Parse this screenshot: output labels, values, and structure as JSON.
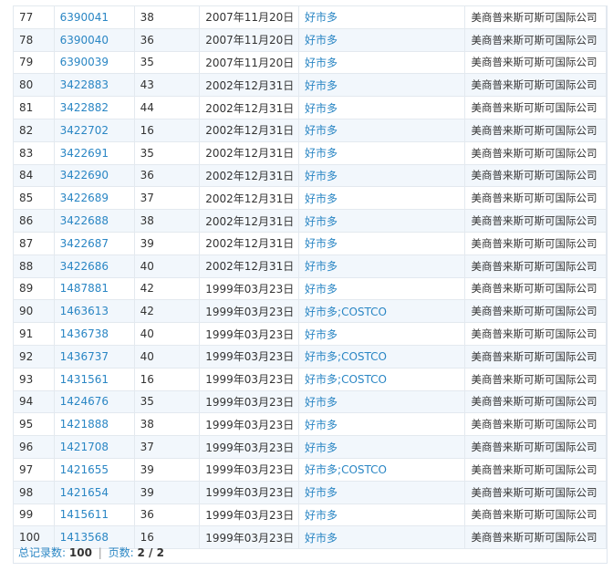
{
  "rows": [
    {
      "idx": "77",
      "reg_no": "6390041",
      "class": "38",
      "date": "2007年11月20日",
      "name": "好市多",
      "owner": "美商普来斯可斯可国际公司"
    },
    {
      "idx": "78",
      "reg_no": "6390040",
      "class": "36",
      "date": "2007年11月20日",
      "name": "好市多",
      "owner": "美商普来斯可斯可国际公司"
    },
    {
      "idx": "79",
      "reg_no": "6390039",
      "class": "35",
      "date": "2007年11月20日",
      "name": "好市多",
      "owner": "美商普来斯可斯可国际公司"
    },
    {
      "idx": "80",
      "reg_no": "3422883",
      "class": "43",
      "date": "2002年12月31日",
      "name": "好市多",
      "owner": "美商普来斯可斯可国际公司"
    },
    {
      "idx": "81",
      "reg_no": "3422882",
      "class": "44",
      "date": "2002年12月31日",
      "name": "好市多",
      "owner": "美商普来斯可斯可国际公司"
    },
    {
      "idx": "82",
      "reg_no": "3422702",
      "class": "16",
      "date": "2002年12月31日",
      "name": "好市多",
      "owner": "美商普来斯可斯可国际公司"
    },
    {
      "idx": "83",
      "reg_no": "3422691",
      "class": "35",
      "date": "2002年12月31日",
      "name": "好市多",
      "owner": "美商普来斯可斯可国际公司"
    },
    {
      "idx": "84",
      "reg_no": "3422690",
      "class": "36",
      "date": "2002年12月31日",
      "name": "好市多",
      "owner": "美商普来斯可斯可国际公司"
    },
    {
      "idx": "85",
      "reg_no": "3422689",
      "class": "37",
      "date": "2002年12月31日",
      "name": "好市多",
      "owner": "美商普来斯可斯可国际公司"
    },
    {
      "idx": "86",
      "reg_no": "3422688",
      "class": "38",
      "date": "2002年12月31日",
      "name": "好市多",
      "owner": "美商普来斯可斯可国际公司"
    },
    {
      "idx": "87",
      "reg_no": "3422687",
      "class": "39",
      "date": "2002年12月31日",
      "name": "好市多",
      "owner": "美商普来斯可斯可国际公司"
    },
    {
      "idx": "88",
      "reg_no": "3422686",
      "class": "40",
      "date": "2002年12月31日",
      "name": "好市多",
      "owner": "美商普来斯可斯可国际公司"
    },
    {
      "idx": "89",
      "reg_no": "1487881",
      "class": "42",
      "date": "1999年03月23日",
      "name": "好市多",
      "owner": "美商普来斯可斯可国际公司"
    },
    {
      "idx": "90",
      "reg_no": "1463613",
      "class": "42",
      "date": "1999年03月23日",
      "name": "好市多;COSTCO",
      "owner": "美商普来斯可斯可国际公司"
    },
    {
      "idx": "91",
      "reg_no": "1436738",
      "class": "40",
      "date": "1999年03月23日",
      "name": "好市多",
      "owner": "美商普来斯可斯可国际公司"
    },
    {
      "idx": "92",
      "reg_no": "1436737",
      "class": "40",
      "date": "1999年03月23日",
      "name": "好市多;COSTCO",
      "owner": "美商普来斯可斯可国际公司"
    },
    {
      "idx": "93",
      "reg_no": "1431561",
      "class": "16",
      "date": "1999年03月23日",
      "name": "好市多;COSTCO",
      "owner": "美商普来斯可斯可国际公司"
    },
    {
      "idx": "94",
      "reg_no": "1424676",
      "class": "35",
      "date": "1999年03月23日",
      "name": "好市多",
      "owner": "美商普来斯可斯可国际公司"
    },
    {
      "idx": "95",
      "reg_no": "1421888",
      "class": "38",
      "date": "1999年03月23日",
      "name": "好市多",
      "owner": "美商普来斯可斯可国际公司"
    },
    {
      "idx": "96",
      "reg_no": "1421708",
      "class": "37",
      "date": "1999年03月23日",
      "name": "好市多",
      "owner": "美商普来斯可斯可国际公司"
    },
    {
      "idx": "97",
      "reg_no": "1421655",
      "class": "39",
      "date": "1999年03月23日",
      "name": "好市多;COSTCO",
      "owner": "美商普来斯可斯可国际公司"
    },
    {
      "idx": "98",
      "reg_no": "1421654",
      "class": "39",
      "date": "1999年03月23日",
      "name": "好市多",
      "owner": "美商普来斯可斯可国际公司"
    },
    {
      "idx": "99",
      "reg_no": "1415611",
      "class": "36",
      "date": "1999年03月23日",
      "name": "好市多",
      "owner": "美商普来斯可斯可国际公司"
    },
    {
      "idx": "100",
      "reg_no": "1413568",
      "class": "16",
      "date": "1999年03月23日",
      "name": "好市多",
      "owner": "美商普来斯可斯可国际公司"
    }
  ],
  "footer": {
    "total_label": "总记录数:",
    "total_value": "100",
    "separator": "|",
    "pages_label": "页数:",
    "pages_value": "2 / 2"
  },
  "colors": {
    "link": "#2a86c4",
    "row_alt": "#f2f7fc",
    "border": "#e3e9ef"
  }
}
